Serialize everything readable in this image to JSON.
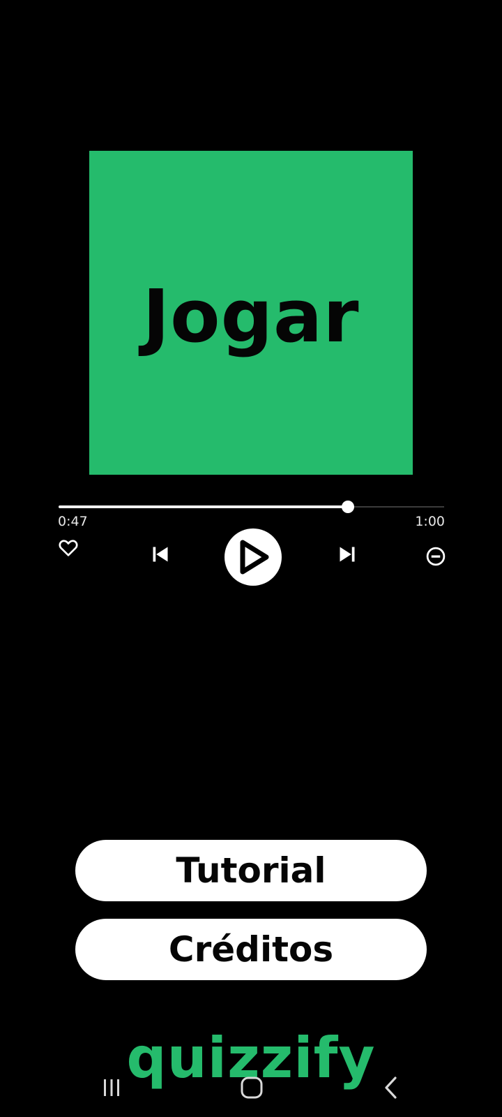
{
  "colors": {
    "accent": "#25bb6c",
    "background": "#000000",
    "button": "#ffffff",
    "button_text": "#050505"
  },
  "cover": {
    "label": "Jogar"
  },
  "player": {
    "elapsed": "0:47",
    "total": "1:00",
    "progress_fraction": 0.75,
    "icons": [
      "heart-icon",
      "skip-previous-icon",
      "play-icon",
      "skip-next-icon",
      "remove-circle-icon"
    ]
  },
  "menu": {
    "tutorial_label": "Tutorial",
    "credits_label": "Créditos"
  },
  "brand": {
    "name": "quizzify"
  },
  "system_nav": {
    "icons": [
      "recent-apps-icon",
      "home-icon",
      "back-icon"
    ]
  }
}
